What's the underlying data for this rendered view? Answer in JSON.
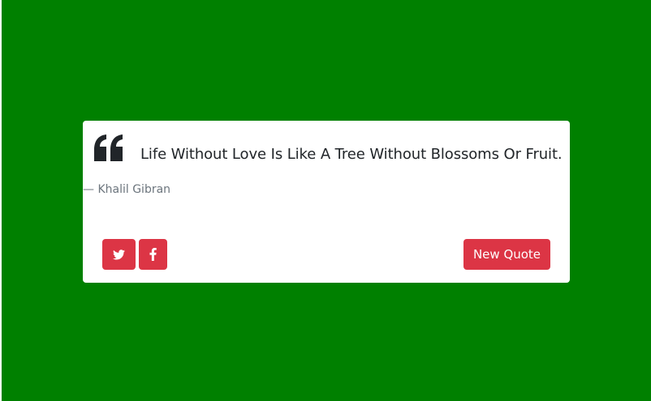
{
  "quote": {
    "text": "Life Without Love Is Like A Tree Without Blossoms Or Fruit.",
    "author": "— Khalil Gibran",
    "icon": "quote-left-icon"
  },
  "buttons": {
    "twitter_icon": "twitter-icon",
    "facebook_icon": "facebook-icon",
    "new_quote_label": "New Quote"
  },
  "colors": {
    "background": "#008000",
    "card": "#ffffff",
    "accent": "#dc3545",
    "text": "#212529",
    "muted": "#6c757d"
  }
}
